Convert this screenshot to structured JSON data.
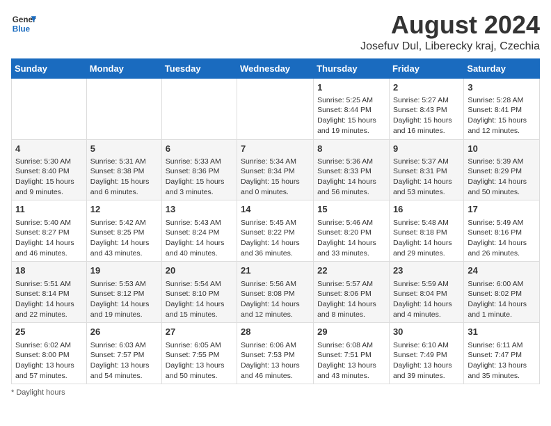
{
  "logo": {
    "line1": "General",
    "line2": "Blue"
  },
  "title": "August 2024",
  "subtitle": "Josefuv Dul, Liberecky kraj, Czechia",
  "days_of_week": [
    "Sunday",
    "Monday",
    "Tuesday",
    "Wednesday",
    "Thursday",
    "Friday",
    "Saturday"
  ],
  "footer": "Daylight hours",
  "weeks": [
    [
      {
        "day": "",
        "sunrise": "",
        "sunset": "",
        "daylight": ""
      },
      {
        "day": "",
        "sunrise": "",
        "sunset": "",
        "daylight": ""
      },
      {
        "day": "",
        "sunrise": "",
        "sunset": "",
        "daylight": ""
      },
      {
        "day": "",
        "sunrise": "",
        "sunset": "",
        "daylight": ""
      },
      {
        "day": "1",
        "sunrise": "Sunrise: 5:25 AM",
        "sunset": "Sunset: 8:44 PM",
        "daylight": "Daylight: 15 hours and 19 minutes."
      },
      {
        "day": "2",
        "sunrise": "Sunrise: 5:27 AM",
        "sunset": "Sunset: 8:43 PM",
        "daylight": "Daylight: 15 hours and 16 minutes."
      },
      {
        "day": "3",
        "sunrise": "Sunrise: 5:28 AM",
        "sunset": "Sunset: 8:41 PM",
        "daylight": "Daylight: 15 hours and 12 minutes."
      }
    ],
    [
      {
        "day": "4",
        "sunrise": "Sunrise: 5:30 AM",
        "sunset": "Sunset: 8:40 PM",
        "daylight": "Daylight: 15 hours and 9 minutes."
      },
      {
        "day": "5",
        "sunrise": "Sunrise: 5:31 AM",
        "sunset": "Sunset: 8:38 PM",
        "daylight": "Daylight: 15 hours and 6 minutes."
      },
      {
        "day": "6",
        "sunrise": "Sunrise: 5:33 AM",
        "sunset": "Sunset: 8:36 PM",
        "daylight": "Daylight: 15 hours and 3 minutes."
      },
      {
        "day": "7",
        "sunrise": "Sunrise: 5:34 AM",
        "sunset": "Sunset: 8:34 PM",
        "daylight": "Daylight: 15 hours and 0 minutes."
      },
      {
        "day": "8",
        "sunrise": "Sunrise: 5:36 AM",
        "sunset": "Sunset: 8:33 PM",
        "daylight": "Daylight: 14 hours and 56 minutes."
      },
      {
        "day": "9",
        "sunrise": "Sunrise: 5:37 AM",
        "sunset": "Sunset: 8:31 PM",
        "daylight": "Daylight: 14 hours and 53 minutes."
      },
      {
        "day": "10",
        "sunrise": "Sunrise: 5:39 AM",
        "sunset": "Sunset: 8:29 PM",
        "daylight": "Daylight: 14 hours and 50 minutes."
      }
    ],
    [
      {
        "day": "11",
        "sunrise": "Sunrise: 5:40 AM",
        "sunset": "Sunset: 8:27 PM",
        "daylight": "Daylight: 14 hours and 46 minutes."
      },
      {
        "day": "12",
        "sunrise": "Sunrise: 5:42 AM",
        "sunset": "Sunset: 8:25 PM",
        "daylight": "Daylight: 14 hours and 43 minutes."
      },
      {
        "day": "13",
        "sunrise": "Sunrise: 5:43 AM",
        "sunset": "Sunset: 8:24 PM",
        "daylight": "Daylight: 14 hours and 40 minutes."
      },
      {
        "day": "14",
        "sunrise": "Sunrise: 5:45 AM",
        "sunset": "Sunset: 8:22 PM",
        "daylight": "Daylight: 14 hours and 36 minutes."
      },
      {
        "day": "15",
        "sunrise": "Sunrise: 5:46 AM",
        "sunset": "Sunset: 8:20 PM",
        "daylight": "Daylight: 14 hours and 33 minutes."
      },
      {
        "day": "16",
        "sunrise": "Sunrise: 5:48 AM",
        "sunset": "Sunset: 8:18 PM",
        "daylight": "Daylight: 14 hours and 29 minutes."
      },
      {
        "day": "17",
        "sunrise": "Sunrise: 5:49 AM",
        "sunset": "Sunset: 8:16 PM",
        "daylight": "Daylight: 14 hours and 26 minutes."
      }
    ],
    [
      {
        "day": "18",
        "sunrise": "Sunrise: 5:51 AM",
        "sunset": "Sunset: 8:14 PM",
        "daylight": "Daylight: 14 hours and 22 minutes."
      },
      {
        "day": "19",
        "sunrise": "Sunrise: 5:53 AM",
        "sunset": "Sunset: 8:12 PM",
        "daylight": "Daylight: 14 hours and 19 minutes."
      },
      {
        "day": "20",
        "sunrise": "Sunrise: 5:54 AM",
        "sunset": "Sunset: 8:10 PM",
        "daylight": "Daylight: 14 hours and 15 minutes."
      },
      {
        "day": "21",
        "sunrise": "Sunrise: 5:56 AM",
        "sunset": "Sunset: 8:08 PM",
        "daylight": "Daylight: 14 hours and 12 minutes."
      },
      {
        "day": "22",
        "sunrise": "Sunrise: 5:57 AM",
        "sunset": "Sunset: 8:06 PM",
        "daylight": "Daylight: 14 hours and 8 minutes."
      },
      {
        "day": "23",
        "sunrise": "Sunrise: 5:59 AM",
        "sunset": "Sunset: 8:04 PM",
        "daylight": "Daylight: 14 hours and 4 minutes."
      },
      {
        "day": "24",
        "sunrise": "Sunrise: 6:00 AM",
        "sunset": "Sunset: 8:02 PM",
        "daylight": "Daylight: 14 hours and 1 minute."
      }
    ],
    [
      {
        "day": "25",
        "sunrise": "Sunrise: 6:02 AM",
        "sunset": "Sunset: 8:00 PM",
        "daylight": "Daylight: 13 hours and 57 minutes."
      },
      {
        "day": "26",
        "sunrise": "Sunrise: 6:03 AM",
        "sunset": "Sunset: 7:57 PM",
        "daylight": "Daylight: 13 hours and 54 minutes."
      },
      {
        "day": "27",
        "sunrise": "Sunrise: 6:05 AM",
        "sunset": "Sunset: 7:55 PM",
        "daylight": "Daylight: 13 hours and 50 minutes."
      },
      {
        "day": "28",
        "sunrise": "Sunrise: 6:06 AM",
        "sunset": "Sunset: 7:53 PM",
        "daylight": "Daylight: 13 hours and 46 minutes."
      },
      {
        "day": "29",
        "sunrise": "Sunrise: 6:08 AM",
        "sunset": "Sunset: 7:51 PM",
        "daylight": "Daylight: 13 hours and 43 minutes."
      },
      {
        "day": "30",
        "sunrise": "Sunrise: 6:10 AM",
        "sunset": "Sunset: 7:49 PM",
        "daylight": "Daylight: 13 hours and 39 minutes."
      },
      {
        "day": "31",
        "sunrise": "Sunrise: 6:11 AM",
        "sunset": "Sunset: 7:47 PM",
        "daylight": "Daylight: 13 hours and 35 minutes."
      }
    ]
  ]
}
